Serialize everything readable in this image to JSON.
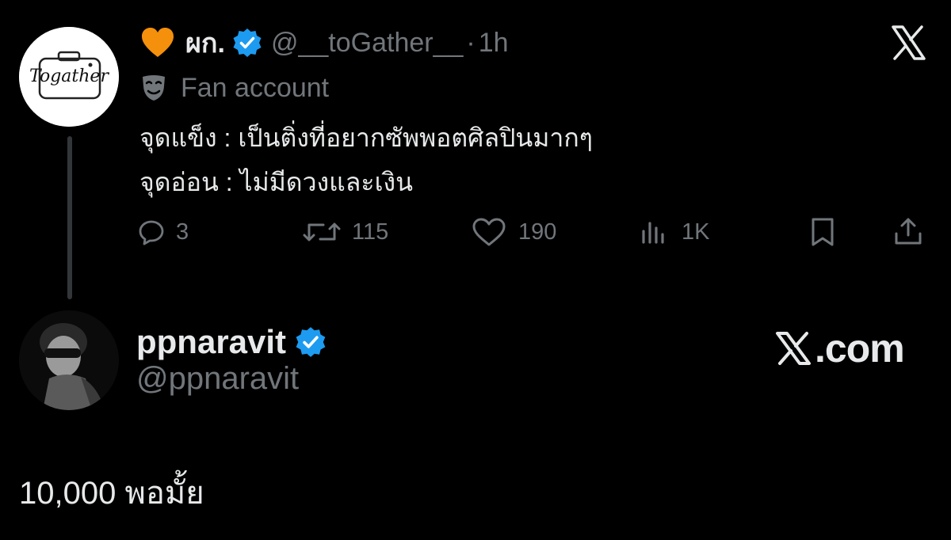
{
  "parent_tweet": {
    "display_name": "ผก.",
    "handle": "@__toGather__",
    "separator": "·",
    "time": "1h",
    "avatar_logo_text": "Togather",
    "label": "Fan account",
    "body_lines": [
      "จุดแข็ง : เป็นติ่งที่อยากซัพพอตศิลปินมากๆ",
      "จุดอ่อน : ไม่มีดวงและเงิน"
    ],
    "actions": {
      "replies": "3",
      "reposts": "115",
      "likes": "190",
      "views": "1K"
    }
  },
  "reply": {
    "display_name": "ppnaravit",
    "handle": "@ppnaravit",
    "text": "10,000 พอมั้ย"
  },
  "branding": {
    "xcom_label": ".com"
  },
  "icons": {
    "heart": "orange-heart-icon",
    "verified": "verified-badge-icon",
    "label": "theater-mask-icon",
    "close": "x-logo-icon",
    "reply": "reply-icon",
    "repost": "repost-icon",
    "like": "like-icon",
    "views": "views-icon",
    "bookmark": "bookmark-icon",
    "share": "share-icon"
  },
  "colors": {
    "background": "#000000",
    "text_primary": "#e7e9ea",
    "text_secondary": "#71767b",
    "verified_blue": "#1d9bf0",
    "heart_orange": "#f4900c",
    "thread_line": "#333639"
  }
}
